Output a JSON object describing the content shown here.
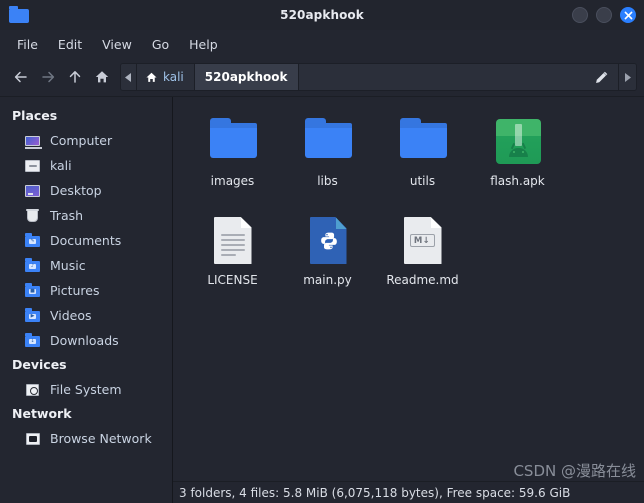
{
  "window": {
    "title": "520apkhook",
    "icon": "folder-icon",
    "controls": [
      {
        "name": "minimize-button",
        "label": ""
      },
      {
        "name": "maximize-button",
        "label": ""
      },
      {
        "name": "close-button",
        "label": "✕"
      }
    ]
  },
  "menubar": {
    "items": [
      {
        "label": "File"
      },
      {
        "label": "Edit"
      },
      {
        "label": "View"
      },
      {
        "label": "Go"
      },
      {
        "label": "Help"
      }
    ]
  },
  "toolbar": {
    "back_icon": "arrow-left-icon",
    "forward_icon": "arrow-right-icon",
    "up_icon": "arrow-up-icon",
    "home_icon": "home-icon",
    "edit_path_icon": "pencil-icon",
    "scroll_left_icon": "triangle-left-icon",
    "scroll_right_icon": "triangle-right-icon"
  },
  "breadcrumbs": [
    {
      "label": "kali",
      "icon": "home-icon",
      "active": false
    },
    {
      "label": "520apkhook",
      "icon": "",
      "active": true
    }
  ],
  "sidebar": {
    "sections": [
      {
        "title": "Places",
        "items": [
          {
            "label": "Computer",
            "icon": "computer-icon"
          },
          {
            "label": "kali",
            "icon": "home-folder-icon"
          },
          {
            "label": "Desktop",
            "icon": "desktop-icon"
          },
          {
            "label": "Trash",
            "icon": "trash-icon"
          },
          {
            "label": "Documents",
            "icon": "documents-folder-icon"
          },
          {
            "label": "Music",
            "icon": "music-folder-icon"
          },
          {
            "label": "Pictures",
            "icon": "pictures-folder-icon"
          },
          {
            "label": "Videos",
            "icon": "videos-folder-icon"
          },
          {
            "label": "Downloads",
            "icon": "downloads-folder-icon"
          }
        ]
      },
      {
        "title": "Devices",
        "items": [
          {
            "label": "File System",
            "icon": "harddisk-icon"
          }
        ]
      },
      {
        "title": "Network",
        "items": [
          {
            "label": "Browse Network",
            "icon": "network-icon"
          }
        ]
      }
    ]
  },
  "files": [
    {
      "name": "images",
      "type": "folder"
    },
    {
      "name": "libs",
      "type": "folder"
    },
    {
      "name": "utils",
      "type": "folder"
    },
    {
      "name": "flash.apk",
      "type": "apk"
    },
    {
      "name": "LICENSE",
      "type": "document"
    },
    {
      "name": "main.py",
      "type": "python"
    },
    {
      "name": "Readme.md",
      "type": "markdown",
      "badge": "M↓"
    }
  ],
  "statusbar": {
    "text": "3 folders, 4 files: 5.8 MiB (6,075,118 bytes), Free space: 59.6 GiB"
  },
  "watermark": {
    "text": "CSDN @漫路在线"
  },
  "colors": {
    "window_bg": "#232630",
    "titlebar_bg": "#22252e",
    "accent_blue": "#2a7fff",
    "folder_blue": "#3b82f6",
    "apk_green": "#3fb469",
    "python_blue": "#2f62b5",
    "text_primary": "#e3e6ec",
    "crumb_link": "#9fc2e8"
  }
}
